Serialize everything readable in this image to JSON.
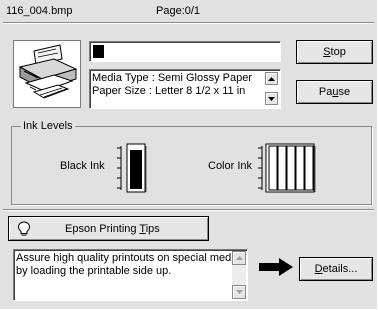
{
  "header": {
    "filename": "116_004.bmp",
    "page": "Page:0/1"
  },
  "progress": {
    "fraction": 0.06
  },
  "media_info": {
    "line1": "Media Type : Semi Glossy Paper",
    "line2": "Paper Size : Letter 8 1/2 x 11 in"
  },
  "buttons": {
    "stop": {
      "pre": "",
      "key": "S",
      "post": "top"
    },
    "pause": {
      "pre": "Pa",
      "key": "u",
      "post": "se"
    },
    "details": {
      "pre": "",
      "key": "D",
      "post": "etails..."
    },
    "tips": {
      "pre": "Epson Printing ",
      "key": "T",
      "post": "ips"
    }
  },
  "ink": {
    "group_label": "Ink Levels",
    "black_label": "Black Ink",
    "color_label": "Color Ink",
    "black_level": 0.93,
    "color_levels": [
      1,
      1,
      1,
      1,
      1
    ]
  },
  "tips_text": {
    "line1": "Assure high quality printouts on special media",
    "line2": "by loading the printable side up."
  },
  "icons": [
    "printer-icon",
    "lightbulb-icon",
    "arrow-right-icon"
  ]
}
